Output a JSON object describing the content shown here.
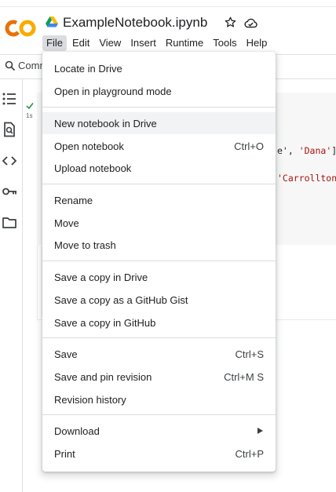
{
  "header": {
    "notebook_title": "ExampleNotebook.ipynb",
    "menus": [
      "File",
      "Edit",
      "View",
      "Insert",
      "Runtime",
      "Tools",
      "Help"
    ],
    "active_menu": "File",
    "brand_colors": {
      "logo_orange": "#f9ab00",
      "logo_dark_orange": "#e8710a"
    }
  },
  "command_bar": {
    "text": "Comm"
  },
  "rail_icons": [
    "table-of-contents-icon",
    "find-icon",
    "code-snippets-icon",
    "secrets-key-icon",
    "files-folder-icon"
  ],
  "cell": {
    "status_icon": "check-icon",
    "exec_time": "1s",
    "code_line_1_pre": "e', ",
    "code_line_1_str": "'Dana'",
    "code_line_1_post": "]",
    "code_line_2_str": "'Carrollton"
  },
  "file_menu": {
    "groups": [
      [
        {
          "label": "Locate in Drive",
          "shortcut": ""
        },
        {
          "label": "Open in playground mode",
          "shortcut": ""
        }
      ],
      [
        {
          "label": "New notebook in Drive",
          "shortcut": "",
          "highlighted": true
        },
        {
          "label": "Open notebook",
          "shortcut": "Ctrl+O"
        },
        {
          "label": "Upload notebook",
          "shortcut": ""
        }
      ],
      [
        {
          "label": "Rename",
          "shortcut": ""
        },
        {
          "label": "Move",
          "shortcut": ""
        },
        {
          "label": "Move to trash",
          "shortcut": ""
        }
      ],
      [
        {
          "label": "Save a copy in Drive",
          "shortcut": ""
        },
        {
          "label": "Save a copy as a GitHub Gist",
          "shortcut": ""
        },
        {
          "label": "Save a copy in GitHub",
          "shortcut": ""
        }
      ],
      [
        {
          "label": "Save",
          "shortcut": "Ctrl+S"
        },
        {
          "label": "Save and pin revision",
          "shortcut": "Ctrl+M S"
        },
        {
          "label": "Revision history",
          "shortcut": ""
        }
      ],
      [
        {
          "label": "Download",
          "shortcut": "",
          "submenu": true
        },
        {
          "label": "Print",
          "shortcut": "Ctrl+P"
        }
      ]
    ]
  }
}
